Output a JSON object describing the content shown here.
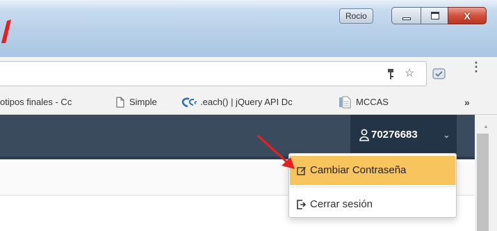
{
  "window": {
    "profile_name": "Rocio",
    "minimize_label": "",
    "maximize_label": "",
    "close_label": "X"
  },
  "toolbar": {
    "key_icon": "key-icon",
    "star_icon": "star-icon",
    "extension_icon": "extension-icon",
    "menu_icon": "vertical-dots-icon",
    "menu_glyph": "⋮"
  },
  "bookmarks": {
    "items": [
      {
        "label": "otipos finales - Cc",
        "icon": "none"
      },
      {
        "label": "Simple",
        "icon": "page-icon"
      },
      {
        "label": ".each() | jQuery API Dc",
        "icon": "jquery-icon"
      },
      {
        "label": "MCCAS",
        "icon": "document-icon"
      }
    ],
    "overflow_glyph": "»"
  },
  "header": {
    "username": "70276683",
    "user_icon": "user-icon",
    "caret_glyph": "⌄"
  },
  "dropdown": {
    "items": [
      {
        "label": "Cambiar Contraseña",
        "icon": "edit-icon",
        "highlighted": true
      },
      {
        "label": "Cerrar sesión",
        "icon": "sign-out-icon",
        "highlighted": false
      }
    ]
  },
  "annotation": {
    "arrow_icon": "red-arrow-icon"
  },
  "colors": {
    "header_bg": "#3a4b5e",
    "user_menu_bg": "#243447",
    "highlight": "#f7c45e",
    "arrow": "#e8201d"
  }
}
